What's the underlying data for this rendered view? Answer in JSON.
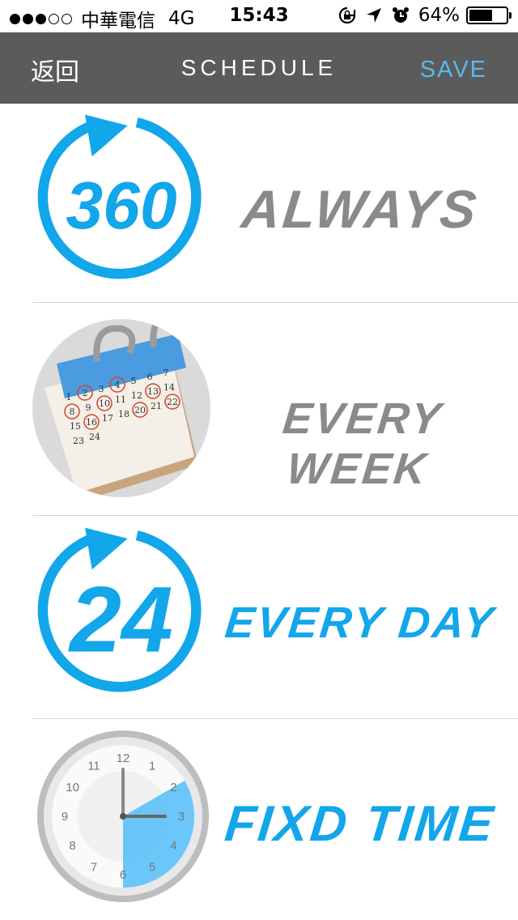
{
  "status_bar": {
    "carrier": "中華電信",
    "network": "4G",
    "time": "15:43",
    "battery": "64%",
    "battery_level": 0.64
  },
  "nav": {
    "back_label": "返回",
    "title": "SCHEDULE",
    "save_label": "SAVE"
  },
  "options": [
    {
      "label": "ALWAYS",
      "icon": "360-icon",
      "icon_text": "360",
      "color": "#8a8a8a"
    },
    {
      "label": "EVERY WEEK",
      "icon": "calendar-icon",
      "color": "#8a8a8a",
      "calendar_numbers": [
        "1",
        "2",
        "3",
        "4",
        "5",
        "6",
        "7",
        "8",
        "9",
        "10",
        "11",
        "12",
        "13",
        "14",
        "15",
        "16",
        "17",
        "18",
        "20",
        "21",
        "22",
        "23",
        "24"
      ]
    },
    {
      "label": "EVERY DAY",
      "icon": "24-icon",
      "icon_text": "24",
      "color": "#12a6ea"
    },
    {
      "label": "FIXD TIME",
      "icon": "clock-icon",
      "color": "#12a6ea",
      "clock_numbers": [
        "12",
        "1",
        "2",
        "3",
        "4",
        "5",
        "6",
        "7",
        "8",
        "9",
        "10",
        "11"
      ]
    }
  ],
  "colors": {
    "accent_blue": "#12a6ea",
    "inactive_gray": "#8a8a8a",
    "nav_bg": "#5b5b5b",
    "save_blue": "#5ab8ea"
  }
}
